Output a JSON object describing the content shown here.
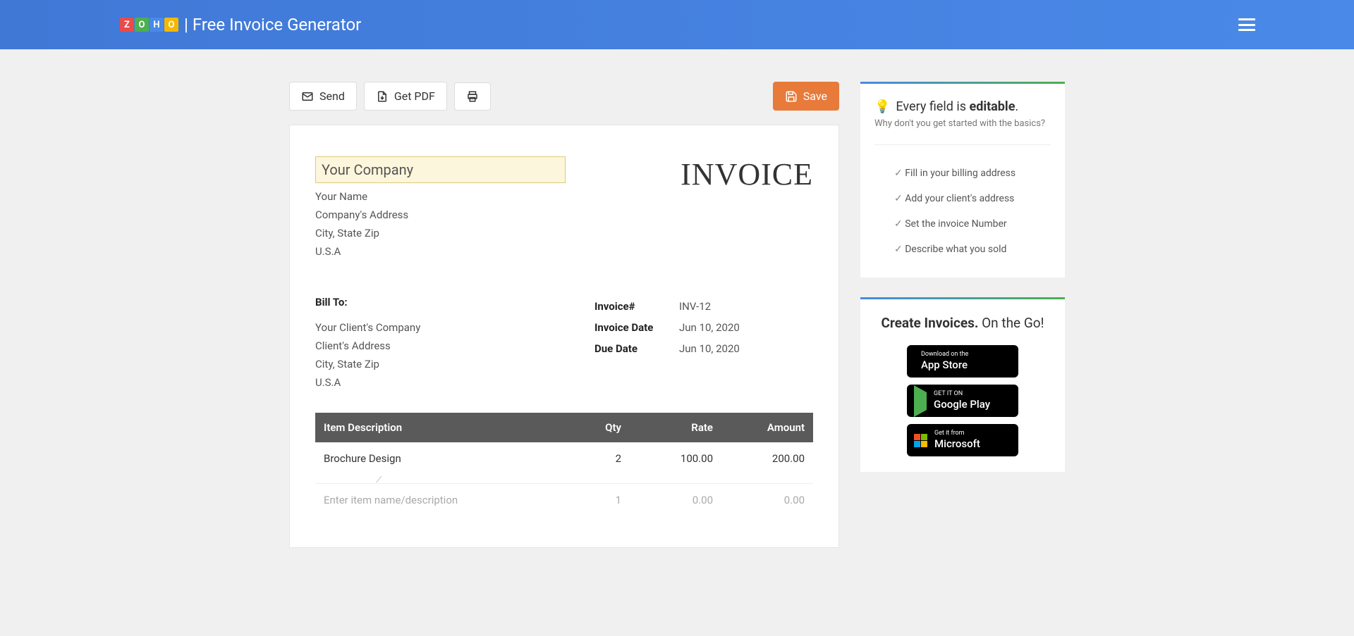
{
  "header": {
    "title": "| Free Invoice Generator"
  },
  "toolbar": {
    "send": "Send",
    "getpdf": "Get PDF",
    "save": "Save"
  },
  "invoice": {
    "title": "INVOICE",
    "company": {
      "name_value": "Your Company",
      "your_name": "Your Name",
      "address": "Company's Address",
      "city": "City, State Zip",
      "country": "U.S.A"
    },
    "bill_to_label": "Bill To:",
    "client": {
      "company": "Your Client's Company",
      "address": "Client's Address",
      "city": "City, State Zip",
      "country": "U.S.A"
    },
    "meta": {
      "number_label": "Invoice#",
      "number_value": "INV-12",
      "date_label": "Invoice Date",
      "date_value": "Jun 10, 2020",
      "due_label": "Due Date",
      "due_value": "Jun 10, 2020"
    },
    "table": {
      "headers": {
        "desc": "Item Description",
        "qty": "Qty",
        "rate": "Rate",
        "amount": "Amount"
      },
      "row1": {
        "desc": "Brochure Design",
        "qty": "2",
        "rate": "100.00",
        "amount": "200.00"
      },
      "placeholder": {
        "desc": "Enter item name/description",
        "qty": "1",
        "rate": "0.00",
        "amount": "0.00"
      }
    }
  },
  "tips": {
    "head_prefix": "Every field is ",
    "head_bold": "editable",
    "head_suffix": ".",
    "sub": "Why don't you get started with the basics?",
    "items": {
      "a": "Fill in your billing address",
      "b": "Add your client's address",
      "c": "Set the invoice Number",
      "d": "Describe what you sold"
    }
  },
  "promo": {
    "head_bold": "Create Invoices.",
    "head_rest": " On the Go!",
    "stores": {
      "apple": {
        "small": "Download on the",
        "big": "App Store"
      },
      "google": {
        "small": "GET IT ON",
        "big": "Google Play"
      },
      "ms": {
        "small": "Get it from",
        "big": "Microsoft"
      }
    }
  }
}
